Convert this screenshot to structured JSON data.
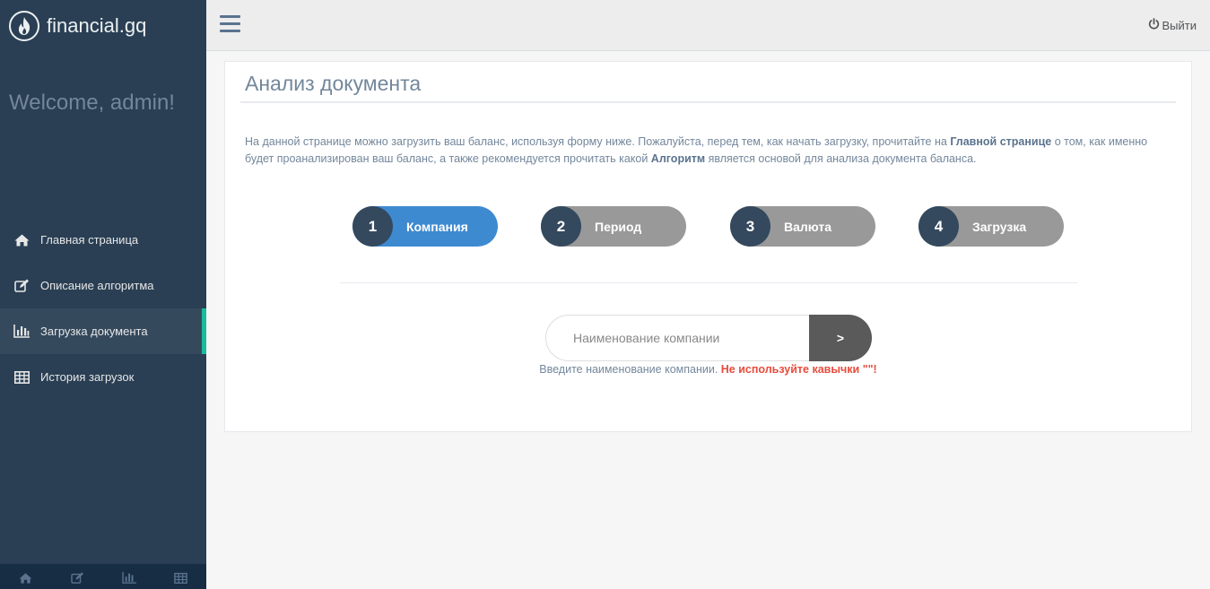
{
  "brand": {
    "name": "financial.gq",
    "logo_icon": "fire-icon"
  },
  "welcome": "Welcome, admin!",
  "sidebar": {
    "items": [
      {
        "label": "Главная страница",
        "icon": "home-icon"
      },
      {
        "label": "Описание алгоритма",
        "icon": "edit-icon"
      },
      {
        "label": "Загрузка документа",
        "icon": "bar-chart-icon",
        "active": true
      },
      {
        "label": "История загрузок",
        "icon": "table-icon"
      }
    ],
    "footer_icons": [
      "home-icon",
      "edit-icon",
      "bar-chart-icon",
      "table-icon"
    ]
  },
  "topnav": {
    "logout_label": "Выйти"
  },
  "panel": {
    "title": "Анализ документа",
    "intro": {
      "p1": "На данной странице можно загрузить ваш баланс, используя форму ниже. Пожалуйста, перед тем, как начать загрузку, прочитайте на ",
      "link1": "Главной странице",
      "p2": " о том, как именно будет проанализирован ваш баланс, а также рекомендуется прочитать какой ",
      "link2": "Алгоритм",
      "p3": " является основой для анализа документа баланса."
    },
    "steps": [
      {
        "num": "1",
        "label": "Компания",
        "active": true
      },
      {
        "num": "2",
        "label": "Период"
      },
      {
        "num": "3",
        "label": "Валюта"
      },
      {
        "num": "4",
        "label": "Загрузка"
      }
    ],
    "form": {
      "placeholder": "Наименование компании",
      "value": "",
      "button_label": ">"
    },
    "hint": {
      "text": "Введите наименование компании. ",
      "warning": "Не используйте кавычки \"\"!"
    }
  },
  "colors": {
    "sidebar_bg": "#2a3f54",
    "active_accent": "#1abb9c",
    "step_active": "#3e8ad0",
    "step_inactive": "#999999",
    "warning": "#e74c3c"
  }
}
